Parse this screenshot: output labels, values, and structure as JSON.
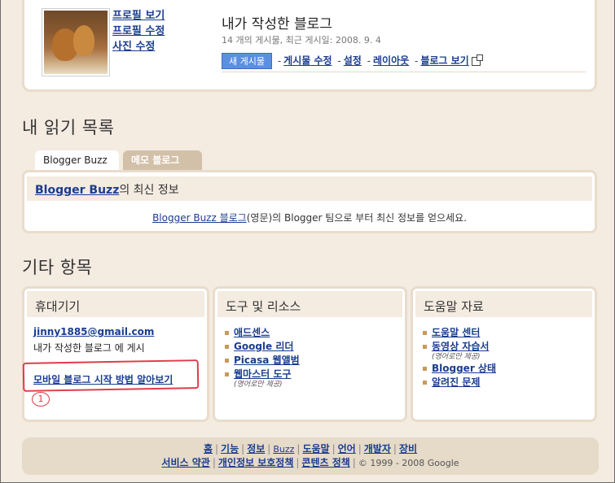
{
  "profile": {
    "links": [
      "프로필 보기",
      "프로필 수정",
      "사진 수정"
    ]
  },
  "blog": {
    "title": "내가 작성한 블로그",
    "meta": "14 개의 게시물, 최근 게시일: 2008. 9. 4",
    "new_post": "새 게시물",
    "actions": [
      "게시물 수정",
      "설정",
      "레이아웃",
      "블로그 보기"
    ]
  },
  "reading_list": {
    "title": "내 읽기 목록",
    "tabs": [
      "Blogger Buzz",
      "메모 블로그"
    ],
    "header_link": "Blogger Buzz",
    "header_suffix": "의 최신 정보",
    "desc_link": "Blogger Buzz 블로그",
    "desc_suffix": "(영문)의 Blogger 팀으로 부터 최신 정보를 얻으세요."
  },
  "other": {
    "title": "기타 항목",
    "mobile": {
      "header": "휴대기기",
      "email": "jinny1885@gmail.com",
      "note": "내가 작성한 블로그 에 게시",
      "learn": "모바일 블로그 시작 방법 알아보기"
    },
    "tools": {
      "header": "도구 및 리소스",
      "items": [
        "애드센스",
        "Google 리더",
        "Picasa 웹앨범",
        "웹마스터 도구"
      ],
      "note": "(영어로만 제공)"
    },
    "help": {
      "header": "도움말 자료",
      "items": [
        "도움말 센터",
        "동영상 자습서",
        "Blogger 상태",
        "알려진 문제"
      ],
      "note": "(영어로만 제공)"
    }
  },
  "annotation": {
    "number": "1"
  },
  "footer": {
    "row1": [
      "홈",
      "기능",
      "정보",
      "Buzz",
      "도움말",
      "언어",
      "개발자",
      "장비"
    ],
    "row2": [
      "서비스 약관",
      "개인정보 보호정책",
      "콘텐츠 정책"
    ],
    "copyright": "© 1999 - 2008 Google"
  }
}
